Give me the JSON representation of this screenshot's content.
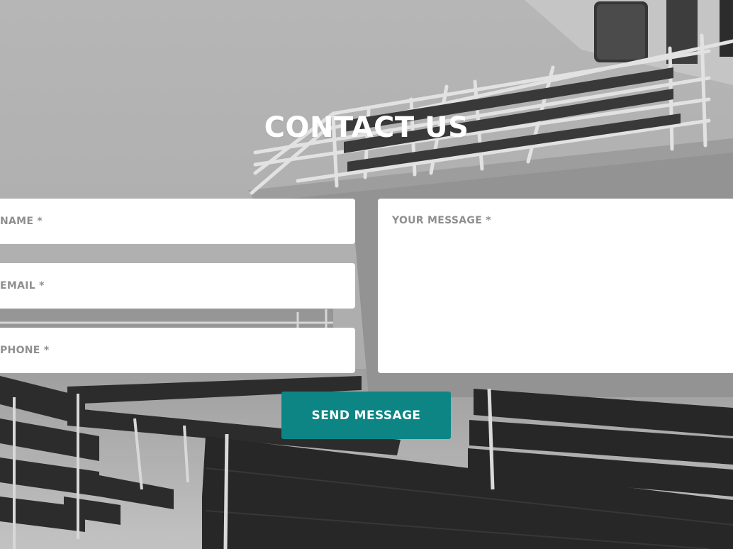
{
  "section": {
    "title": "CONTACT US"
  },
  "form": {
    "name_placeholder": "NAME *",
    "email_placeholder": "EMAIL *",
    "phone_placeholder": "PHONE *",
    "message_placeholder": "YOUR MESSAGE *",
    "submit_label": "SEND MESSAGE"
  },
  "colors": {
    "accent": "#0d8585",
    "field_background": "#ffffff",
    "title_text": "#ffffff",
    "placeholder_text": "#8f8f8f"
  }
}
